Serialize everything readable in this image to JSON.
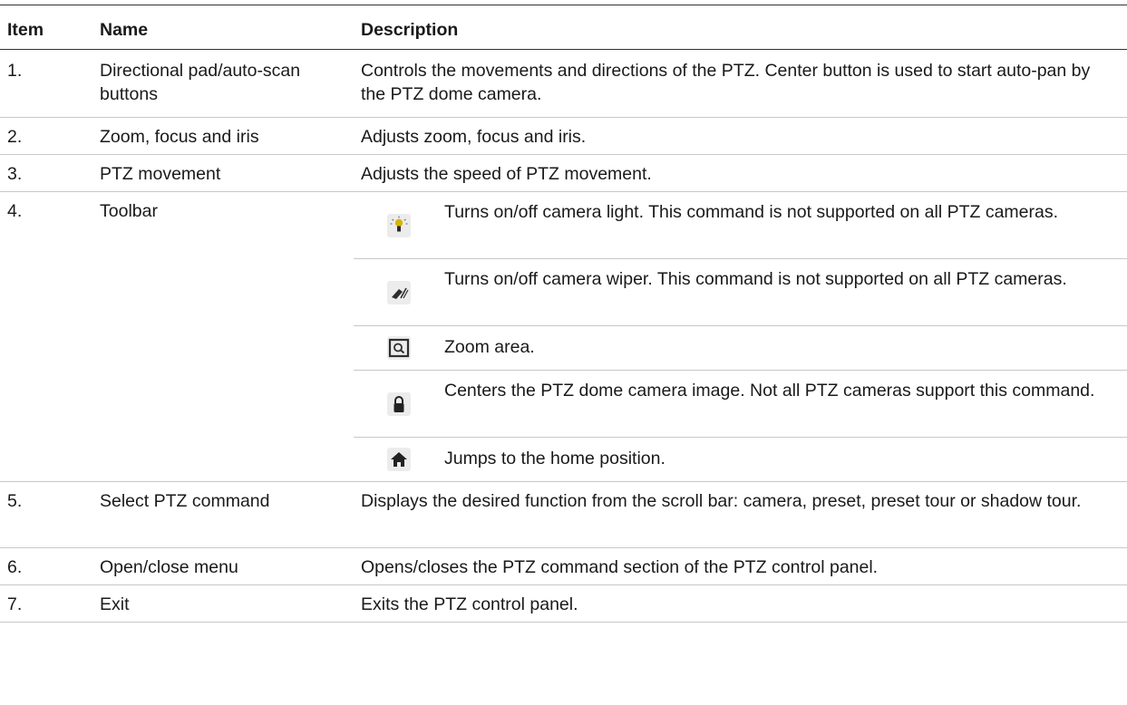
{
  "table": {
    "headers": {
      "item": "Item",
      "name": "Name",
      "description": "Description"
    },
    "rows": [
      {
        "item": "1.",
        "name": "Directional pad/auto-scan buttons",
        "description": "Controls the movements and directions of the PTZ. Center button is used to start auto-pan by the PTZ dome camera."
      },
      {
        "item": "2.",
        "name": "Zoom, focus and iris",
        "description": "Adjusts zoom, focus and iris."
      },
      {
        "item": "3.",
        "name": "PTZ movement",
        "description": "Adjusts the speed of PTZ movement."
      },
      {
        "item": "4.",
        "name": "Toolbar",
        "subitems": [
          {
            "icon": "light-icon",
            "description": "Turns on/off camera light. This command is not supported on all PTZ cameras."
          },
          {
            "icon": "wiper-icon",
            "description": "Turns on/off camera wiper. This command is not supported on all PTZ cameras."
          },
          {
            "icon": "zoom-area-icon",
            "description": "Zoom area."
          },
          {
            "icon": "lock-icon",
            "description": "Centers the PTZ dome camera image. Not all PTZ cameras support this command."
          },
          {
            "icon": "home-icon",
            "description": "Jumps to the home position."
          }
        ]
      },
      {
        "item": "5.",
        "name": "Select PTZ command",
        "description": "Displays the desired function from the scroll bar: camera, preset, preset tour or shadow tour."
      },
      {
        "item": "6.",
        "name": "Open/close menu",
        "description": "Opens/closes the PTZ command section of the PTZ control panel."
      },
      {
        "item": "7.",
        "name": "Exit",
        "description": "Exits the PTZ control panel."
      }
    ]
  }
}
